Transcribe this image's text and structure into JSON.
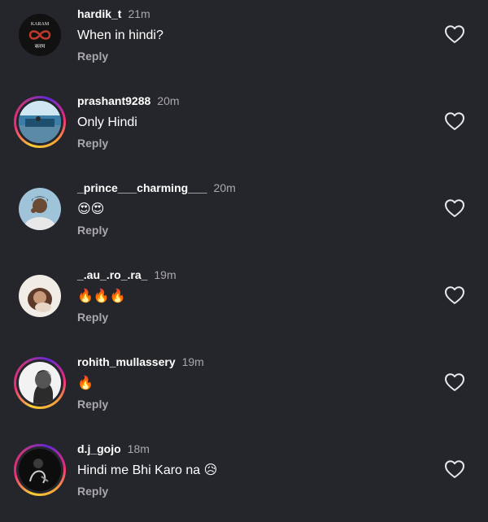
{
  "comments": [
    {
      "username": "hardik_t",
      "time": "21m",
      "text": "When in hindi?",
      "reply_label": "Reply",
      "avatar_text_top": "KARAM",
      "avatar_text_bottom": "करम",
      "has_story_ring": false
    },
    {
      "username": "prashant9288",
      "time": "20m",
      "text": "Only Hindi",
      "reply_label": "Reply",
      "has_story_ring": true
    },
    {
      "username": "_prince___charming___",
      "time": "20m",
      "text": "😍😍",
      "reply_label": "Reply",
      "has_story_ring": false
    },
    {
      "username": "_.au_.ro_.ra_",
      "time": "19m",
      "text": "🔥🔥🔥",
      "reply_label": "Reply",
      "has_story_ring": false
    },
    {
      "username": "rohith_mullassery",
      "time": "19m",
      "text": "🔥",
      "reply_label": "Reply",
      "has_story_ring": true
    },
    {
      "username": "d.j_gojo",
      "time": "18m",
      "text": "Hindi me Bhi Karo na",
      "text_emoji": "😥",
      "reply_label": "Reply",
      "has_story_ring": true
    }
  ],
  "colors": {
    "background": "#25262b",
    "secondary_text": "#a8a8ae",
    "primary_text": "#ffffff"
  },
  "icons": {
    "like": "heart-outline-icon"
  }
}
